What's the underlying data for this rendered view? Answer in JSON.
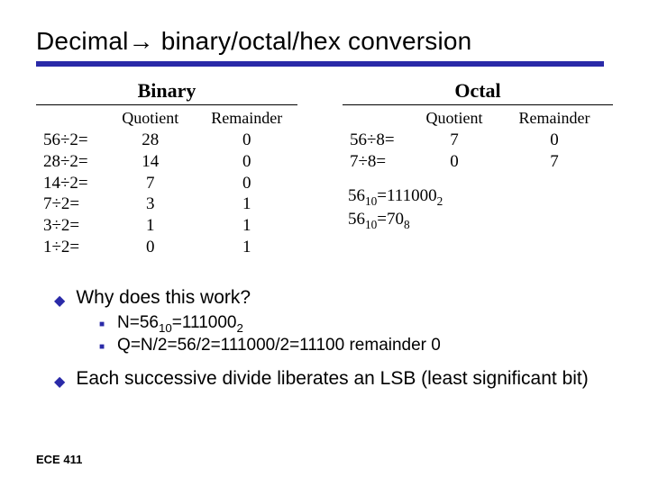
{
  "title": "Decimal→ binary/octal/hex conversion",
  "binary": {
    "heading": "Binary",
    "cols": {
      "op": "",
      "q": "Quotient",
      "r": "Remainder"
    },
    "rows": [
      {
        "op": "56÷2=",
        "q": "28",
        "r": "0"
      },
      {
        "op": "28÷2=",
        "q": "14",
        "r": "0"
      },
      {
        "op": "14÷2=",
        "q": "7",
        "r": "0"
      },
      {
        "op": "7÷2=",
        "q": "3",
        "r": "1"
      },
      {
        "op": "3÷2=",
        "q": "1",
        "r": "1"
      },
      {
        "op": "1÷2=",
        "q": "0",
        "r": "1"
      }
    ]
  },
  "octal": {
    "heading": "Octal",
    "cols": {
      "op": "",
      "q": "Quotient",
      "r": "Remainder"
    },
    "rows": [
      {
        "op": "56÷8=",
        "q": "7",
        "r": "0"
      },
      {
        "op": "7÷8=",
        "q": "0",
        "r": "7"
      }
    ],
    "summary": [
      {
        "lhs": "56",
        "lsub": "10",
        "eq": "=",
        "rhs": "111000",
        "rsub": "2"
      },
      {
        "lhs": "56",
        "lsub": "10",
        "eq": "=",
        "rhs": "70",
        "rsub": "8"
      }
    ]
  },
  "bullets": {
    "why": "Why does this work?",
    "sub1": {
      "pre": "N=56",
      "s1": "10",
      "mid": "=111000",
      "s2": "2"
    },
    "sub2": "Q=N/2=56/2=111000/2=11100 remainder 0",
    "each": "Each successive divide liberates an LSB (least significant bit)"
  },
  "footer": "ECE 411"
}
